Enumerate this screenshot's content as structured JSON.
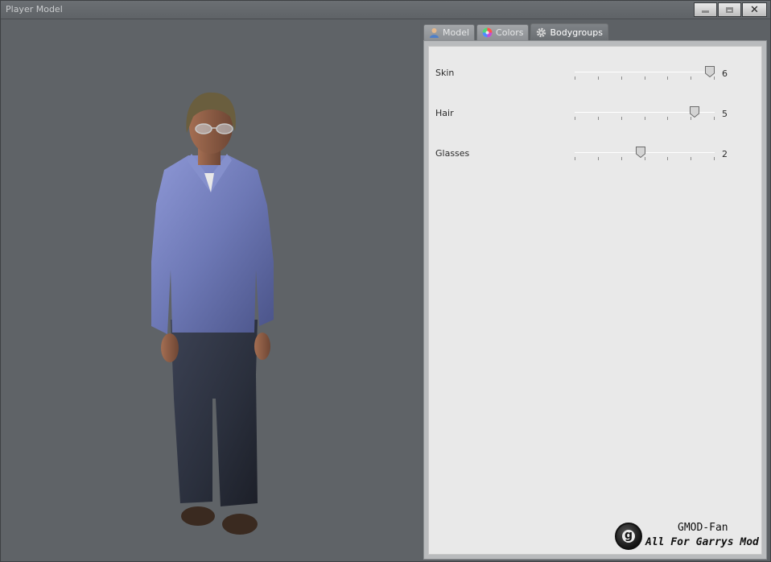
{
  "window": {
    "title": "Player Model",
    "minimize_icon": "minimize-icon",
    "maximize_icon": "maximize-icon",
    "close_glyph": "✕"
  },
  "tabs": [
    {
      "label": "Model",
      "icon": "person-icon",
      "active": false
    },
    {
      "label": "Colors",
      "icon": "color-wheel-icon",
      "active": false
    },
    {
      "label": "Bodygroups",
      "icon": "gear-icon",
      "active": true
    }
  ],
  "bodygroups": [
    {
      "label": "Skin",
      "value": "6",
      "level": 1.0
    },
    {
      "label": "Hair",
      "value": "5",
      "level": 0.885
    },
    {
      "label": "Glasses",
      "value": "2",
      "level": 0.47
    }
  ],
  "watermark": {
    "logo_letter": "g",
    "line1": "GMOD-Fan",
    "line2": "All For Garrys Mod"
  },
  "colors": {
    "viewport_bg": "#5f6367",
    "panel_bg": "#e9e9e9",
    "shirt": "#6f7bb8",
    "jeans": "#2f3442"
  }
}
